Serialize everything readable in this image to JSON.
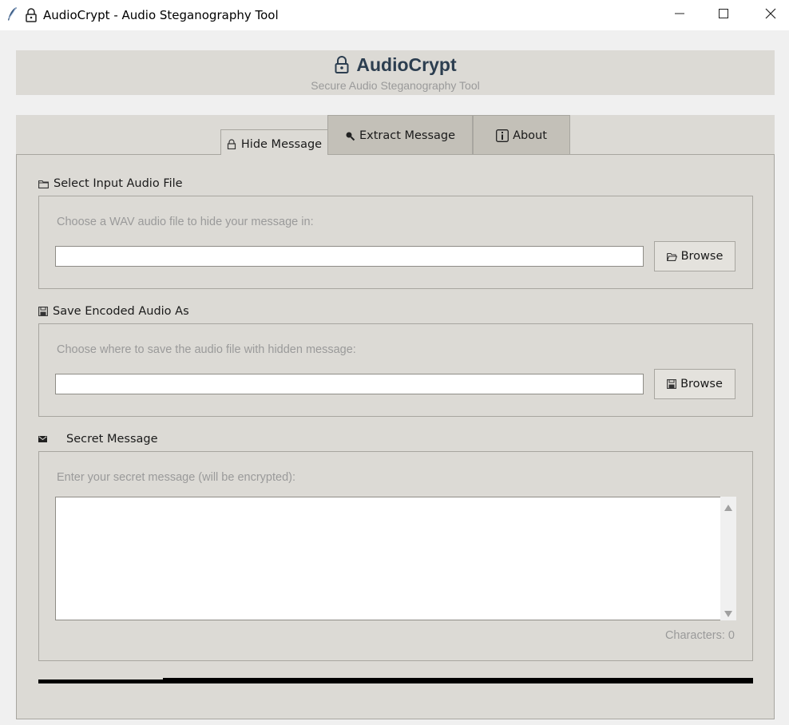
{
  "window": {
    "title": "AudioCrypt - Audio Steganography Tool",
    "app_icon": "feather-icon",
    "lock_icon": "lock-icon",
    "controls": [
      "minimize-icon",
      "maximize-icon",
      "close-icon"
    ]
  },
  "header": {
    "title": "AudioCrypt",
    "subtitle": "Secure Audio Steganography Tool",
    "title_color": "#2c3e50"
  },
  "tabs": [
    {
      "label": "Hide Message",
      "icon": "lock-icon",
      "selected": true
    },
    {
      "label": "Extract Message",
      "icon": "magnifier-icon",
      "selected": false
    },
    {
      "label": "About",
      "icon": "info-icon",
      "selected": false
    }
  ],
  "input_section": {
    "label": "Select Input Audio File",
    "icon": "folder-icon",
    "hint": "Choose a WAV audio file to hide your message in:",
    "value": "",
    "browse_label": "Browse"
  },
  "output_section": {
    "label": "Save Encoded Audio As",
    "icon": "floppy-icon",
    "hint": "Choose where to save the audio file with hidden message:",
    "value": "",
    "browse_label": "Browse"
  },
  "message_section": {
    "label": "Secret Message",
    "icon": "envelope-icon",
    "hint": "Enter your secret message (will be encrypted):",
    "value": "",
    "char_count": "Characters: 0"
  },
  "progress": {
    "value": 0.17
  }
}
